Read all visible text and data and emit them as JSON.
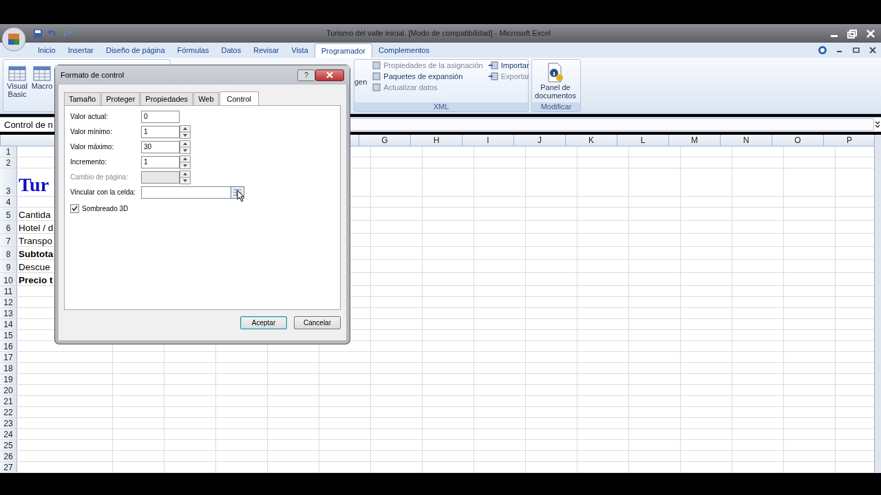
{
  "window": {
    "title": "Turismo del valle inicial. [Modo de compatibilidad] - Microsoft Excel"
  },
  "ribbon_tabs": [
    {
      "label": "Inicio",
      "selected": false
    },
    {
      "label": "Insertar",
      "selected": false
    },
    {
      "label": "Diseño de página",
      "selected": false
    },
    {
      "label": "Fórmulas",
      "selected": false
    },
    {
      "label": "Datos",
      "selected": false
    },
    {
      "label": "Revisar",
      "selected": false
    },
    {
      "label": "Vista",
      "selected": false
    },
    {
      "label": "Programador",
      "selected": true
    },
    {
      "label": "Complementos",
      "selected": false
    }
  ],
  "ribbon": {
    "code_buttons": [
      "Visual Basic",
      "Macro"
    ],
    "cut_label": "gen",
    "xml_group": {
      "label": "XML",
      "items": [
        {
          "label": "Propiedades de la asignación",
          "disabled": true
        },
        {
          "label": "Paquetes de expansión",
          "disabled": false
        },
        {
          "label": "Actualizar datos",
          "disabled": true
        }
      ],
      "side_items": [
        {
          "label": "Importar",
          "disabled": false
        },
        {
          "label": "Exportar",
          "disabled": true
        }
      ]
    },
    "modify_group": {
      "label": "Modificar",
      "button": "Panel de documentos"
    }
  },
  "name_box": "Control de n",
  "sheet": {
    "columns": [
      "G",
      "H",
      "I",
      "J",
      "K",
      "L",
      "M",
      "N",
      "O",
      "P"
    ],
    "rows": [
      {
        "number": "1",
        "text": "",
        "kind": "plain"
      },
      {
        "number": "2",
        "text": "",
        "kind": "plain"
      },
      {
        "number": "3",
        "text": "Tur",
        "kind": "title"
      },
      {
        "number": "4",
        "text": "",
        "kind": "plain"
      },
      {
        "number": "5",
        "text": "Cantida",
        "kind": "plain"
      },
      {
        "number": "6",
        "text": "Hotel / d",
        "kind": "plain"
      },
      {
        "number": "7",
        "text": "Transpo",
        "kind": "plain"
      },
      {
        "number": "8",
        "text": "Subtota",
        "kind": "bold"
      },
      {
        "number": "9",
        "text": "Descue",
        "kind": "plain"
      },
      {
        "number": "10",
        "text": "Precio t",
        "kind": "bold"
      },
      {
        "number": "11",
        "text": "",
        "kind": "plain"
      },
      {
        "number": "12",
        "text": "",
        "kind": "plain"
      },
      {
        "number": "13",
        "text": "",
        "kind": "plain"
      },
      {
        "number": "14",
        "text": "",
        "kind": "plain"
      },
      {
        "number": "15",
        "text": "",
        "kind": "plain"
      },
      {
        "number": "16",
        "text": "",
        "kind": "plain"
      },
      {
        "number": "17",
        "text": "",
        "kind": "plain"
      },
      {
        "number": "18",
        "text": "",
        "kind": "plain"
      },
      {
        "number": "19",
        "text": "",
        "kind": "plain"
      },
      {
        "number": "20",
        "text": "",
        "kind": "plain"
      },
      {
        "number": "21",
        "text": "",
        "kind": "plain"
      },
      {
        "number": "22",
        "text": "",
        "kind": "plain"
      },
      {
        "number": "23",
        "text": "",
        "kind": "plain"
      },
      {
        "number": "24",
        "text": "",
        "kind": "plain"
      },
      {
        "number": "25",
        "text": "",
        "kind": "plain"
      },
      {
        "number": "26",
        "text": "",
        "kind": "plain"
      },
      {
        "number": "27",
        "text": "",
        "kind": "plain"
      }
    ]
  },
  "dialog": {
    "title": "Formato de control",
    "help": "?",
    "tabs": [
      {
        "label": "Tamaño",
        "selected": false
      },
      {
        "label": "Proteger",
        "selected": false
      },
      {
        "label": "Propiedades",
        "selected": false
      },
      {
        "label": "Web",
        "selected": false
      },
      {
        "label": "Control",
        "selected": true
      }
    ],
    "fields": [
      {
        "label": "Valor actual:",
        "value": "0",
        "kind": "text",
        "disabled": false
      },
      {
        "label": "Valor mínimo:",
        "value": "1",
        "kind": "spin",
        "disabled": false
      },
      {
        "label": "Valor máximo:",
        "value": "30",
        "kind": "spin",
        "disabled": false
      },
      {
        "label": "Incremento:",
        "value": "1",
        "kind": "spin",
        "disabled": false
      },
      {
        "label": "Cambio de página:",
        "kind": "spin",
        "disabled": true
      },
      {
        "label": "Vincular con la celda:",
        "kind": "ref",
        "disabled": false
      }
    ],
    "checkbox": {
      "label": "Sombreado 3D",
      "checked": true
    },
    "buttons": [
      {
        "label": "Aceptar",
        "default": true
      },
      {
        "label": "Cancelar",
        "default": false
      }
    ]
  }
}
